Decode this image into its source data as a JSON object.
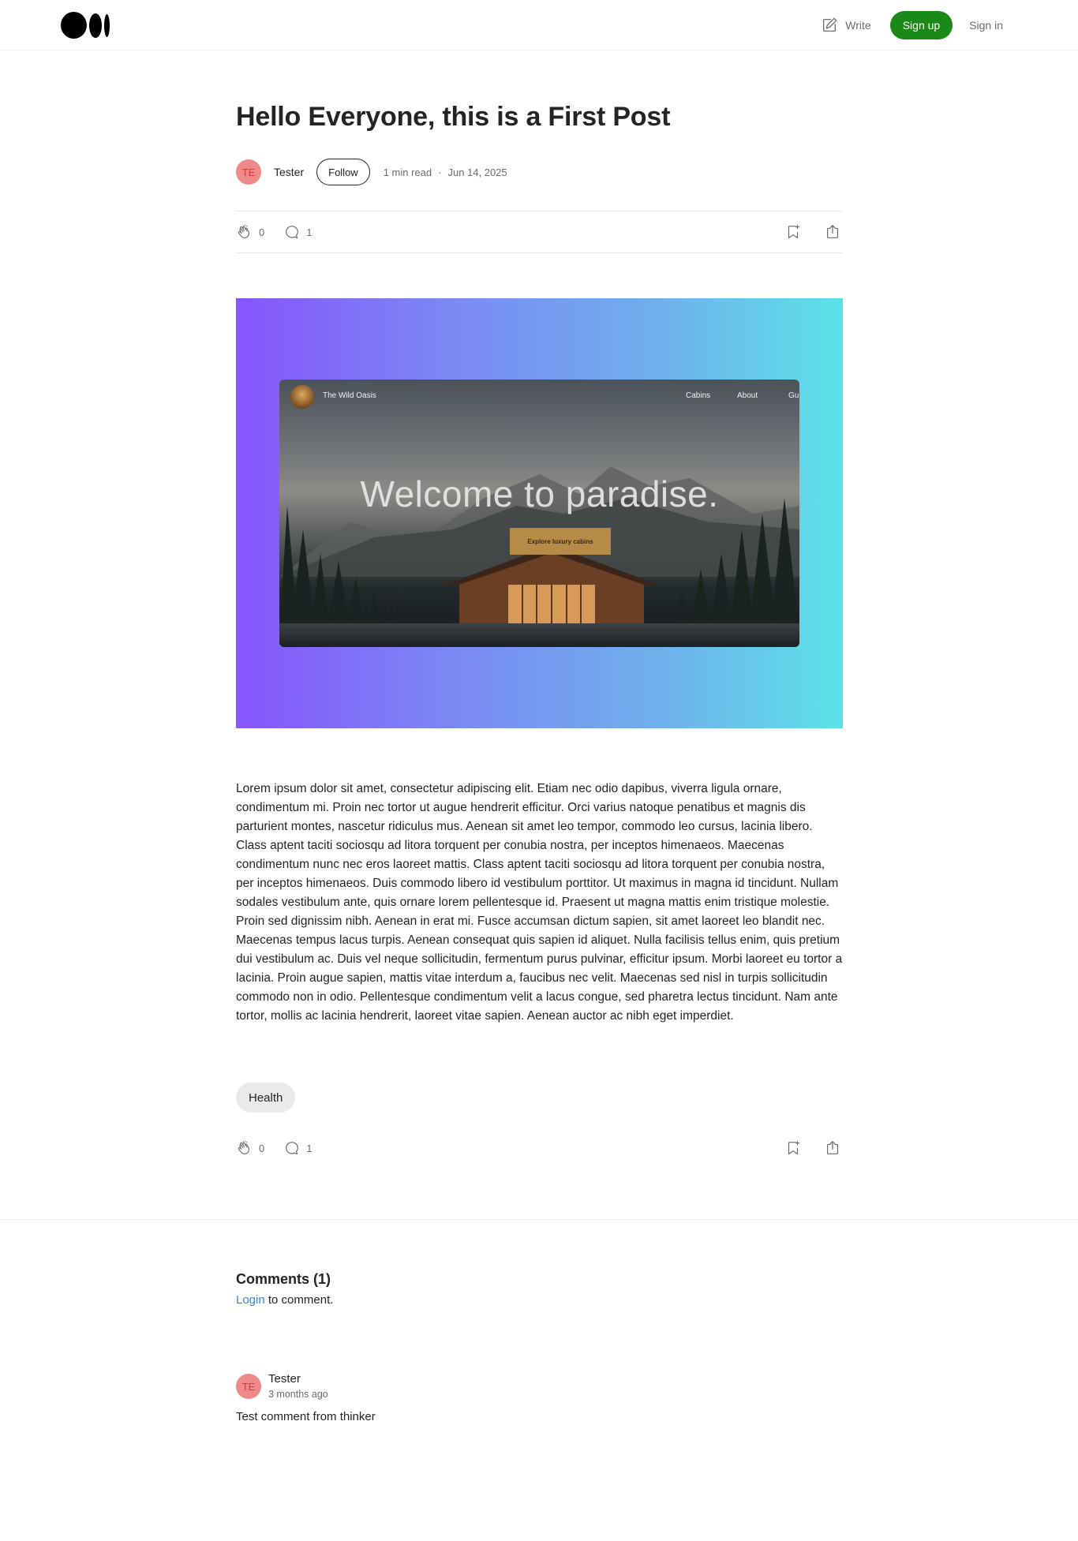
{
  "header": {
    "write_label": "Write",
    "signup_label": "Sign up",
    "signin_label": "Sign in",
    "accent_color": "#1a8917"
  },
  "article": {
    "title": "Hello Everyone, this is a First Post",
    "author_initials": "TE",
    "author": "Tester",
    "follow_label": "Follow",
    "read_time": "1 min read",
    "separator": "·",
    "date": "Jun 14, 2025",
    "claps": "0",
    "responses": "1",
    "hero": {
      "brand": "The Wild Oasis",
      "nav_links": [
        "Cabins",
        "About",
        "Gu"
      ],
      "headline": "Welcome to paradise.",
      "cta": "Explore luxury cabins",
      "gradient_start": "#8655fc",
      "gradient_end": "#5ce2e8"
    },
    "body": "Lorem ipsum dolor sit amet, consectetur adipiscing elit. Etiam nec odio dapibus, viverra ligula ornare, condimentum mi. Proin nec tortor ut augue hendrerit efficitur. Orci varius natoque penatibus et magnis dis parturient montes, nascetur ridiculus mus. Aenean sit amet leo tempor, commodo leo cursus, lacinia libero. Class aptent taciti sociosqu ad litora torquent per conubia nostra, per inceptos himenaeos. Maecenas condimentum nunc nec eros laoreet mattis. Class aptent taciti sociosqu ad litora torquent per conubia nostra, per inceptos himenaeos. Duis commodo libero id vestibulum porttitor. Ut maximus in magna id tincidunt. Nullam sodales vestibulum ante, quis ornare lorem pellentesque id. Praesent ut magna mattis enim tristique molestie. Proin sed dignissim nibh. Aenean in erat mi. Fusce accumsan dictum sapien, sit amet laoreet leo blandit nec. Maecenas tempus lacus turpis. Aenean consequat quis sapien id aliquet. Nulla facilisis tellus enim, quis pretium dui vestibulum ac. Duis vel neque sollicitudin, fermentum purus pulvinar, efficitur ipsum. Morbi laoreet eu tortor a lacinia. Proin augue sapien, mattis vitae interdum a, faucibus nec velit. Maecenas sed nisl in turpis sollicitudin commodo non in odio. Pellentesque condimentum velit a lacus congue, sed pharetra lectus tincidunt. Nam ante tortor, mollis ac lacinia hendrerit, laoreet vitae sapien. Aenean auctor ac nibh eget imperdiet.",
    "tag": "Health"
  },
  "comments": {
    "title": "Comments (1)",
    "login_link": "Login",
    "login_suffix": " to comment.",
    "items": [
      {
        "initials": "TE",
        "author": "Tester",
        "time": "3 months ago",
        "text": "Test comment from thinker"
      }
    ]
  }
}
